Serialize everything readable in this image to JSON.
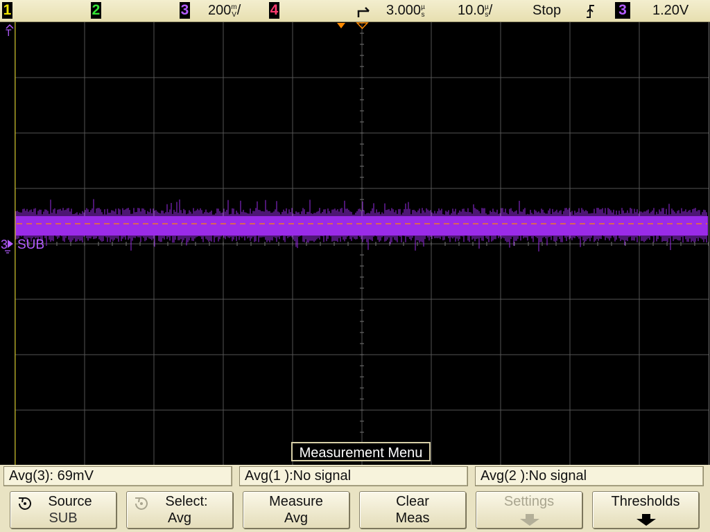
{
  "status": {
    "ch1_label": "1",
    "ch2_label": "2",
    "ch3_label": "3",
    "ch3_scale": "200",
    "ch3_scale_unit_top": "m",
    "ch3_scale_unit_bottom": "V",
    "ch3_scale_suffix": "/",
    "ch4_label": "4",
    "trigger_delay": "3.000",
    "trigger_delay_unit": "s",
    "trigger_delay_prefix": "µ",
    "timebase": "10.0",
    "timebase_prefix": "µ",
    "timebase_unit": "s",
    "timebase_suffix": "/",
    "run_state": "Stop",
    "trigger_source": "3",
    "trigger_level": "1.20V"
  },
  "screen": {
    "trigger_marker": "T",
    "channel3_ground_label": "3",
    "channel3_name": "SUB",
    "trace_level_volts": 0.069
  },
  "menu": {
    "title": "Measurement Menu"
  },
  "measurements": [
    {
      "text": "Avg(3): 69mV"
    },
    {
      "text": "Avg(1 ):No signal"
    },
    {
      "text": "Avg(2 ):No signal"
    }
  ],
  "softkeys": [
    {
      "line1": "Source",
      "line2": "SUB",
      "icon": "rotate-knob-icon",
      "enabled": true
    },
    {
      "line1": "Select:",
      "line2": "Avg",
      "icon": "rotate-knob-icon",
      "enabled": true
    },
    {
      "line1": "Measure",
      "line2": "Avg",
      "enabled": true
    },
    {
      "line1": "Clear",
      "line2": "Meas",
      "enabled": true
    },
    {
      "line1": "Settings",
      "icon": "arrow-down-icon",
      "enabled": false
    },
    {
      "line1": "Thresholds",
      "icon": "arrow-down-icon",
      "enabled": true
    }
  ],
  "colors": {
    "ch1": "#f2e600",
    "ch2": "#36e636",
    "ch3": "#9a2be8",
    "ch4": "#ff3a6e",
    "trigger": "#ff8a00",
    "grid": "#5a5a5a"
  }
}
